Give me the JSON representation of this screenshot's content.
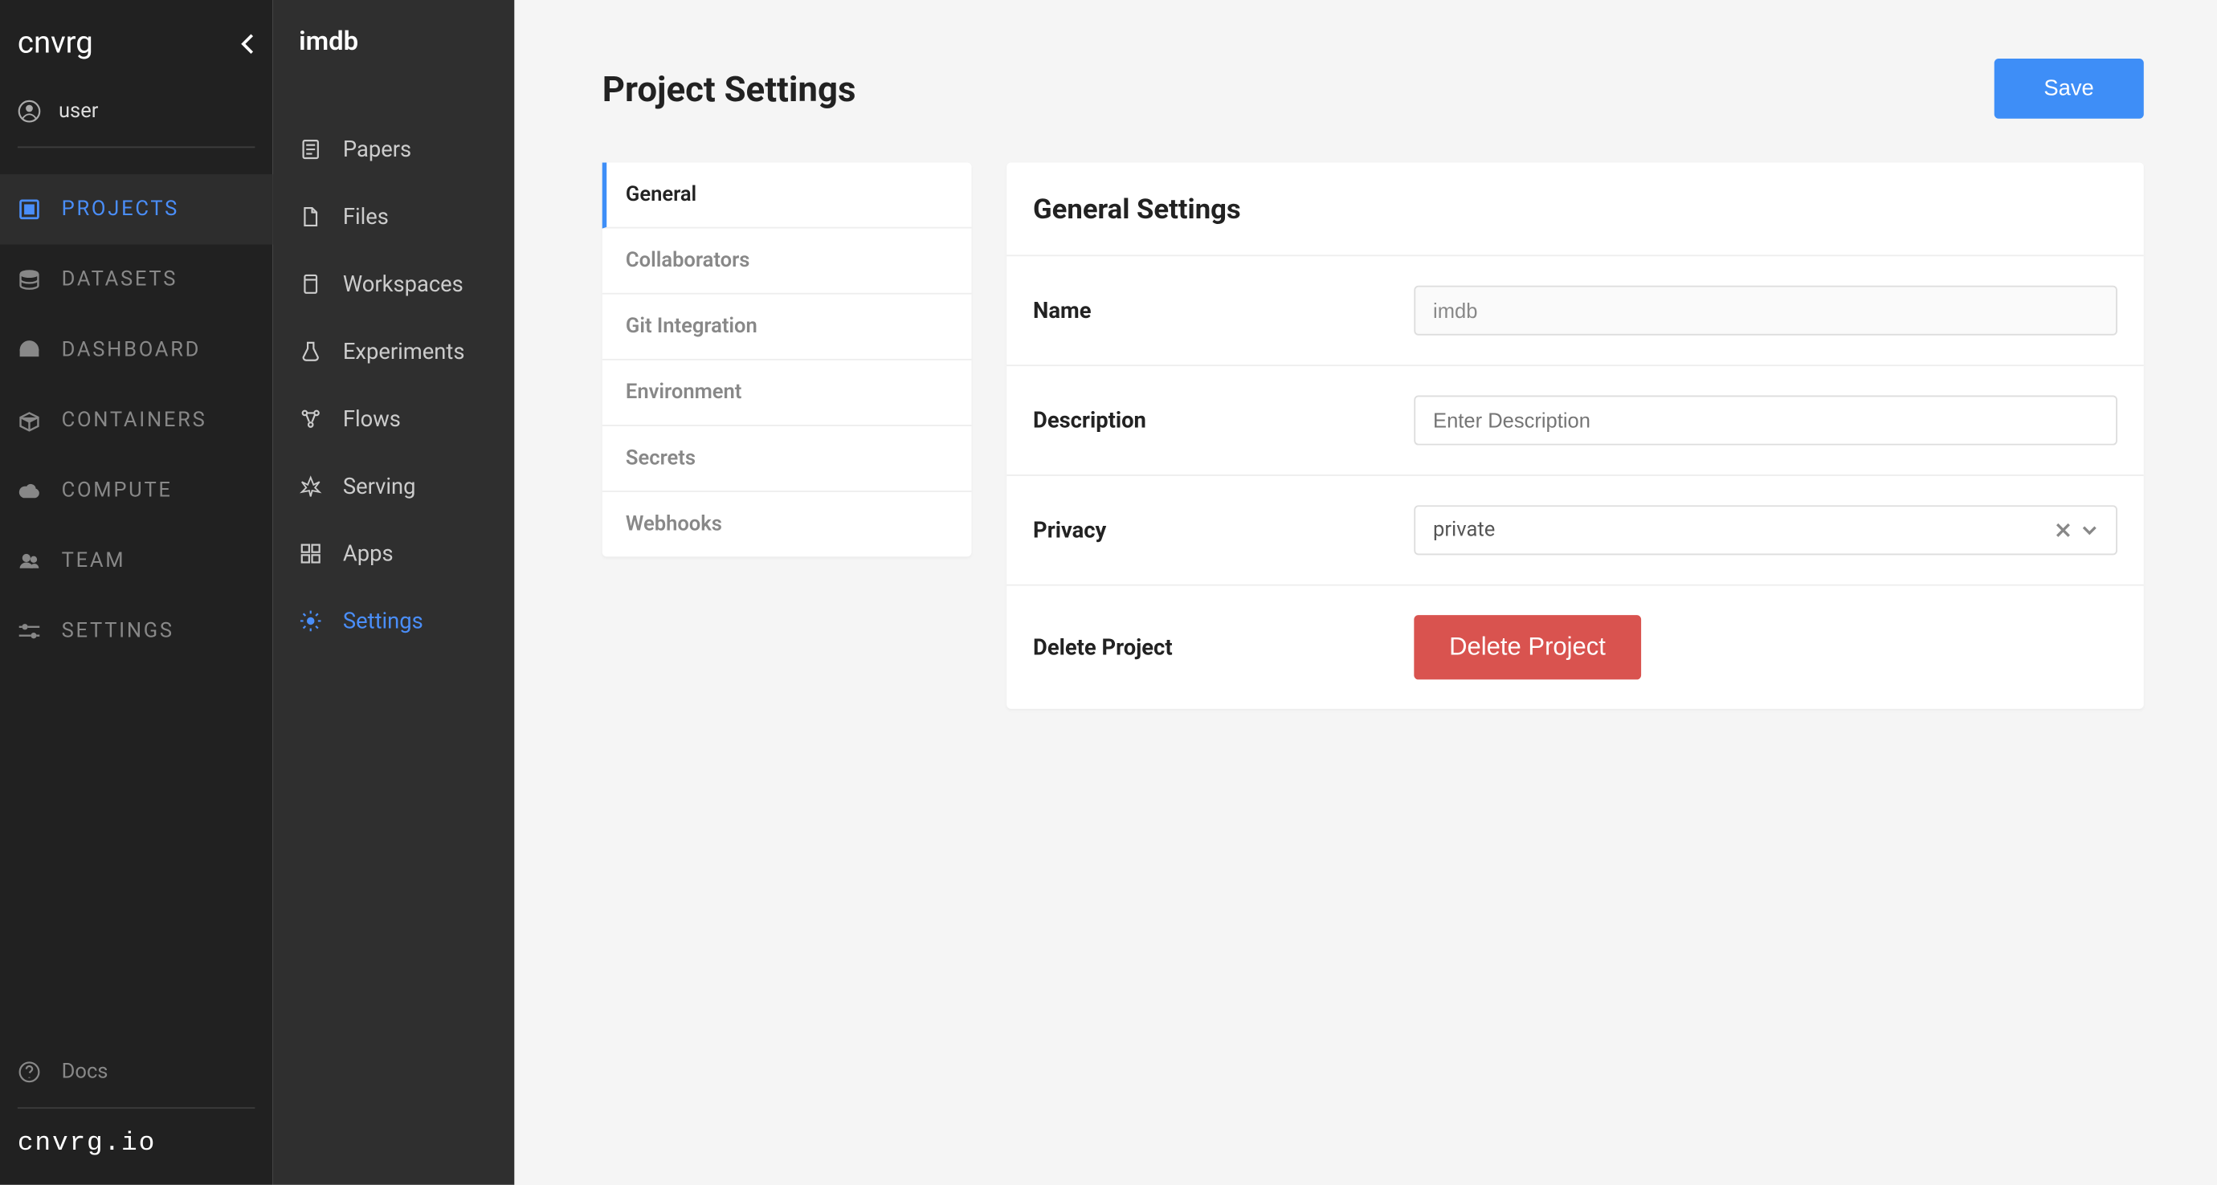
{
  "brand": "cnvrg",
  "user_label": "user",
  "primary_nav": [
    {
      "label": "PROJECTS",
      "icon": "rect"
    },
    {
      "label": "DATASETS",
      "icon": "db"
    },
    {
      "label": "DASHBOARD",
      "icon": "dash"
    },
    {
      "label": "CONTAINERS",
      "icon": "box"
    },
    {
      "label": "COMPUTE",
      "icon": "cloud"
    },
    {
      "label": "TEAM",
      "icon": "team"
    },
    {
      "label": "SETTINGS",
      "icon": "gear"
    }
  ],
  "docs_label": "Docs",
  "footer_brand": "cnvrg.io",
  "project_name": "imdb",
  "secondary_nav": [
    {
      "label": "Papers"
    },
    {
      "label": "Files"
    },
    {
      "label": "Workspaces"
    },
    {
      "label": "Experiments"
    },
    {
      "label": "Flows"
    },
    {
      "label": "Serving"
    },
    {
      "label": "Apps"
    },
    {
      "label": "Settings"
    }
  ],
  "page_title": "Project Settings",
  "save_label": "Save",
  "settings_tabs": [
    "General",
    "Collaborators",
    "Git Integration",
    "Environment",
    "Secrets",
    "Webhooks"
  ],
  "panel_title": "General Settings",
  "form": {
    "name_label": "Name",
    "name_value": "imdb",
    "description_label": "Description",
    "description_placeholder": "Enter Description",
    "privacy_label": "Privacy",
    "privacy_value": "private",
    "delete_label": "Delete Project",
    "delete_button": "Delete Project"
  }
}
